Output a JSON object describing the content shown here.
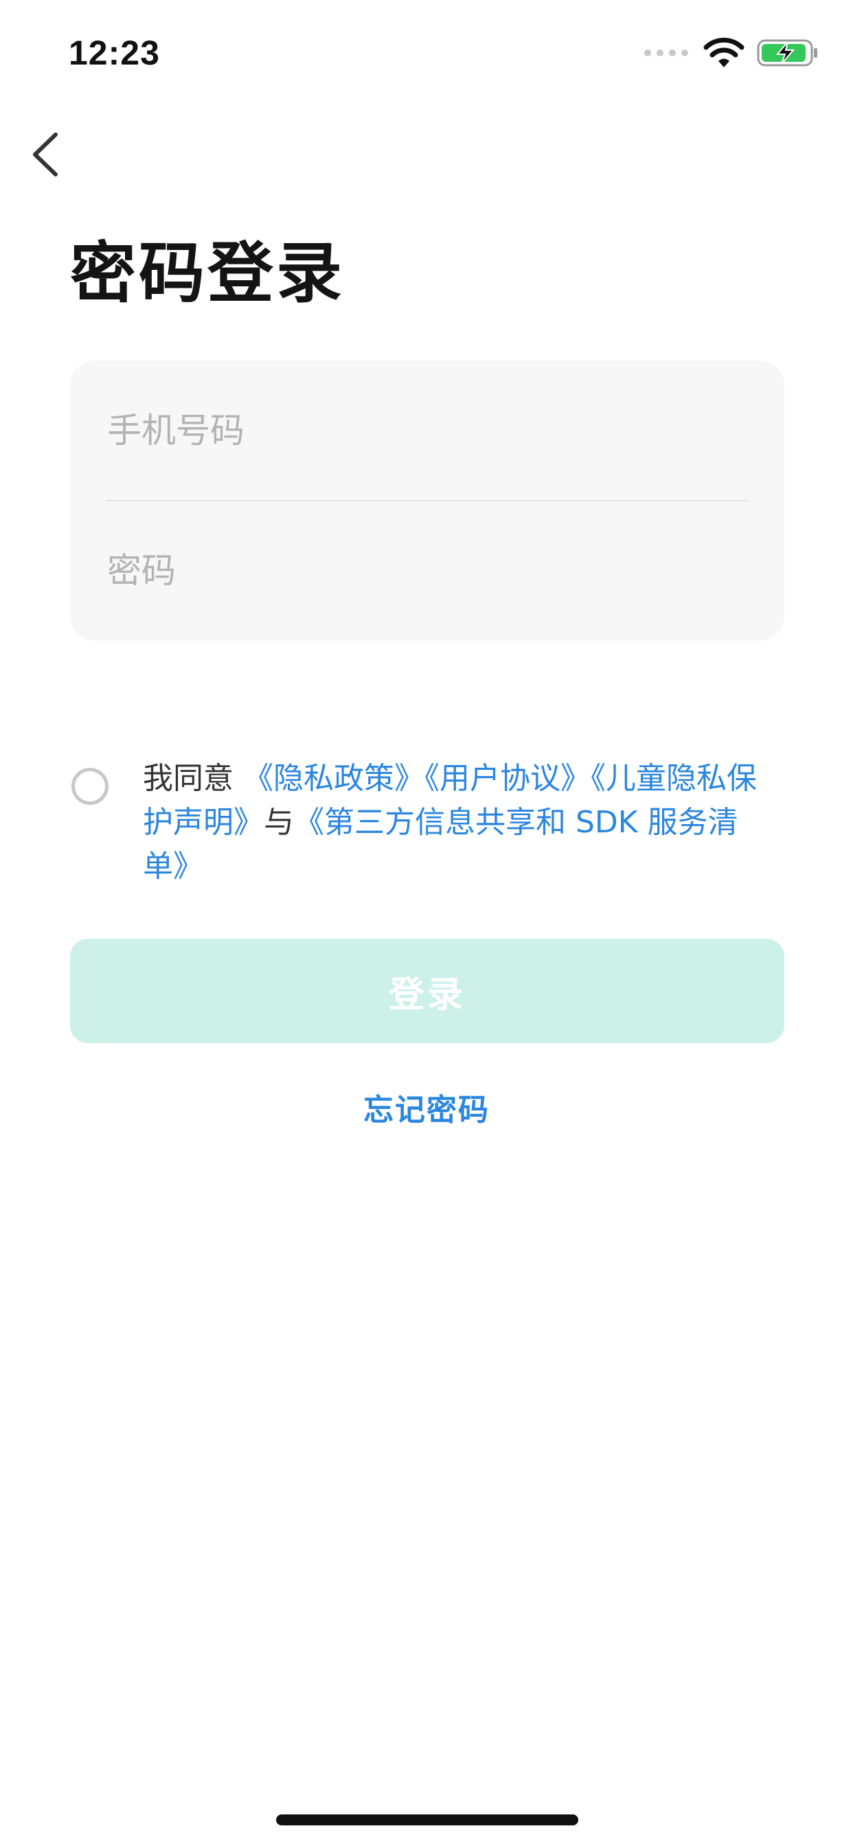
{
  "status_bar": {
    "time": "12:23",
    "icons": [
      "signal-icon",
      "wifi-icon",
      "battery-charging-icon"
    ],
    "battery_color": "#34c759"
  },
  "nav": {
    "back_icon": "chevron-left-icon"
  },
  "page": {
    "title": "密码登录"
  },
  "form": {
    "phone_placeholder": "手机号码",
    "phone_value": "",
    "password_placeholder": "密码",
    "password_value": ""
  },
  "agreement": {
    "checked": false,
    "prefix": "我同意",
    "privacy_policy": "《隐私政策》",
    "user_agreement": "《用户协议》",
    "child_privacy": "《儿童隐私保护声明》",
    "connector": "与",
    "third_party": "《第三方信息共享和 SDK 服务清单》"
  },
  "login_button": {
    "label": "登录",
    "disabled": true,
    "color": "#cdf0e9"
  },
  "forgot_password": {
    "label": "忘记密码"
  },
  "colors": {
    "link": "#2b86e0",
    "title": "#141414",
    "placeholder": "#b3b3b3"
  }
}
